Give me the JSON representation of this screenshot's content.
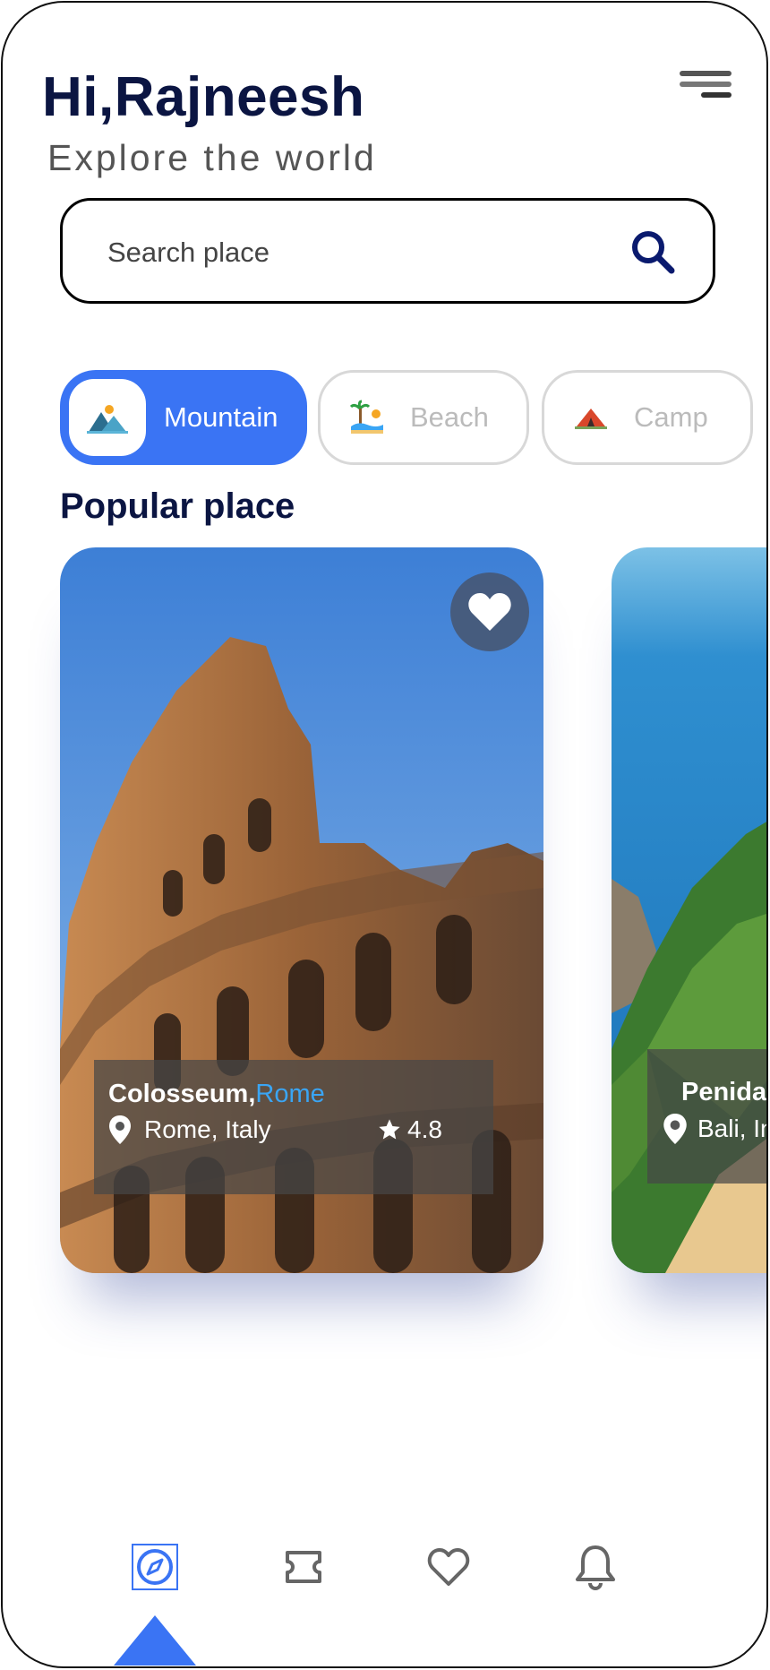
{
  "header": {
    "greeting": "Hi,Rajneesh",
    "subtitle": "Explore the world",
    "menu_icon": "hamburger-menu-icon"
  },
  "search": {
    "placeholder": "Search place",
    "icon": "search-icon"
  },
  "categories": [
    {
      "label": "Mountain",
      "icon": "mountain-icon",
      "active": true
    },
    {
      "label": "Beach",
      "icon": "beach-icon",
      "active": false
    },
    {
      "label": "Camp",
      "icon": "camp-tent-icon",
      "active": false
    }
  ],
  "popular": {
    "title": "Popular place",
    "places": [
      {
        "name": "Colosseum,",
        "city": "Rome",
        "location": "Rome, Italy",
        "rating": "4.8",
        "favorite": true
      },
      {
        "name": "Penida",
        "location": "Bali, In"
      }
    ]
  },
  "bottom_nav": [
    {
      "icon": "compass-icon",
      "active": true
    },
    {
      "icon": "ticket-icon",
      "active": false
    },
    {
      "icon": "heart-icon",
      "active": false
    },
    {
      "icon": "bell-icon",
      "active": false
    }
  ],
  "colors": {
    "primary": "#3a74f4",
    "title": "#0b1542",
    "accent_city": "#3aa5f4"
  }
}
